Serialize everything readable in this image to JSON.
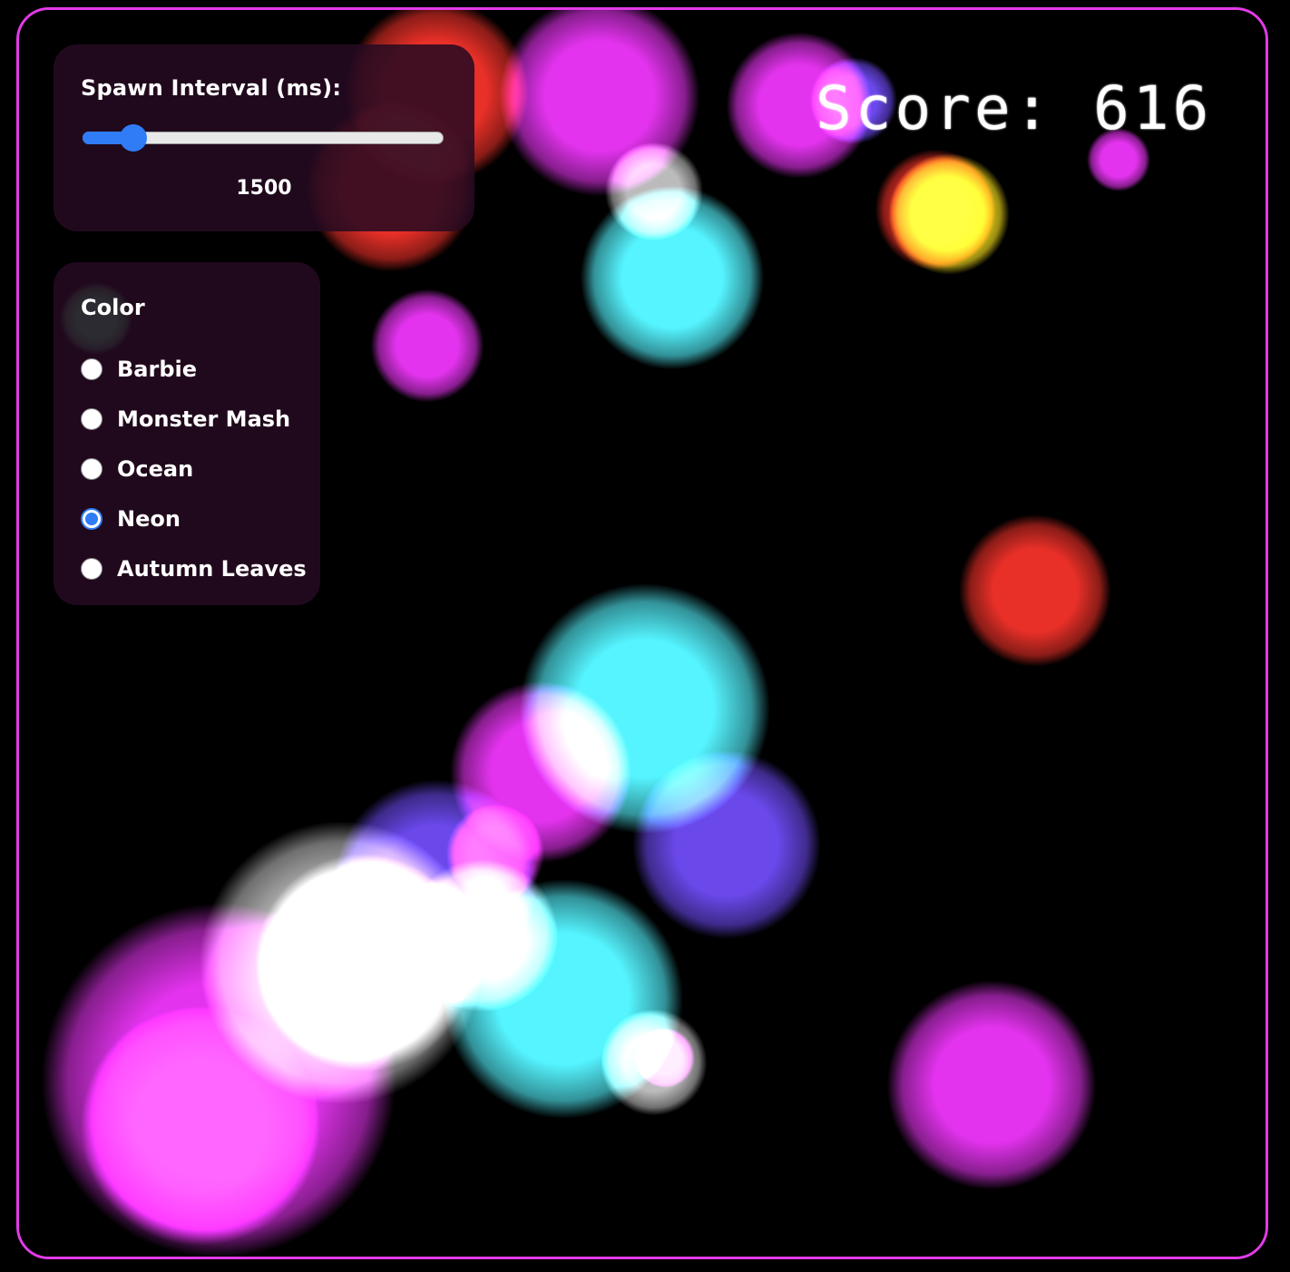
{
  "game": {
    "score_label": "Score:",
    "score": 616
  },
  "spawn": {
    "label": "Spawn Interval (ms):",
    "value": "1500",
    "slider_fraction": 0.14
  },
  "color": {
    "title": "Color",
    "options": [
      {
        "label": "Barbie",
        "checked": false
      },
      {
        "label": "Monster Mash",
        "checked": false
      },
      {
        "label": "Ocean",
        "checked": false
      },
      {
        "label": "Neon",
        "checked": true
      },
      {
        "label": "Autumn Leaves",
        "checked": false
      }
    ],
    "selected": "Neon"
  },
  "colors": {
    "frame_border": "#e23be8",
    "panel_bg": "#260a22",
    "accent": "#2f7cf6",
    "neon_palette": [
      "#e83af0",
      "#7ff8ff",
      "#ffffff",
      "#e8362e",
      "#ffee33",
      "#7b55ee",
      "#7ff5b0"
    ]
  }
}
